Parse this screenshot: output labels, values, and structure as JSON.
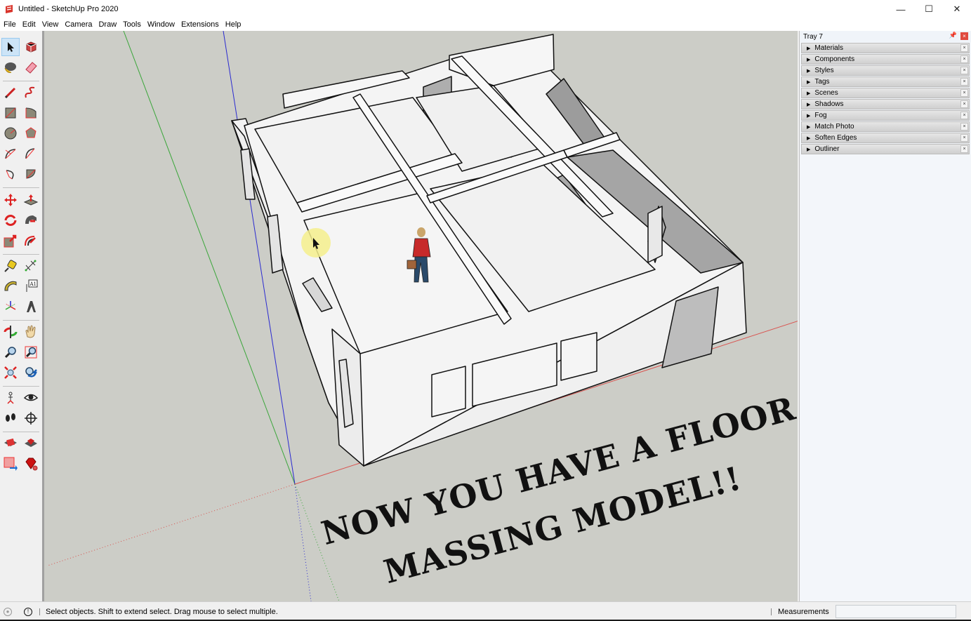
{
  "window": {
    "title": "Untitled - SketchUp Pro 2020",
    "controls": {
      "minimize": "—",
      "maximize": "☐",
      "close": "✕"
    }
  },
  "menubar": {
    "items": [
      {
        "label": "File"
      },
      {
        "label": "Edit"
      },
      {
        "label": "View"
      },
      {
        "label": "Camera"
      },
      {
        "label": "Draw"
      },
      {
        "label": "Tools"
      },
      {
        "label": "Window"
      },
      {
        "label": "Extensions"
      },
      {
        "label": "Help"
      }
    ]
  },
  "toolbar": {
    "tools": [
      {
        "name": "select-tool",
        "active": true
      },
      {
        "name": "make-component-tool"
      },
      {
        "name": "paint-bucket-tool"
      },
      {
        "name": "eraser-tool"
      },
      {
        "name": "line-tool"
      },
      {
        "name": "freehand-tool"
      },
      {
        "name": "rectangle-tool"
      },
      {
        "name": "rotated-rectangle-tool"
      },
      {
        "name": "circle-tool"
      },
      {
        "name": "polygon-tool"
      },
      {
        "name": "arc-tool"
      },
      {
        "name": "two-point-arc-tool"
      },
      {
        "name": "three-point-arc-tool"
      },
      {
        "name": "pie-tool"
      },
      {
        "name": "move-tool"
      },
      {
        "name": "push-pull-tool"
      },
      {
        "name": "rotate-tool"
      },
      {
        "name": "follow-me-tool"
      },
      {
        "name": "scale-tool"
      },
      {
        "name": "offset-tool"
      },
      {
        "name": "tape-measure-tool"
      },
      {
        "name": "dimension-tool"
      },
      {
        "name": "protractor-tool"
      },
      {
        "name": "text-tool"
      },
      {
        "name": "axes-tool"
      },
      {
        "name": "3d-text-tool"
      },
      {
        "name": "orbit-tool"
      },
      {
        "name": "pan-tool"
      },
      {
        "name": "zoom-tool"
      },
      {
        "name": "zoom-window-tool"
      },
      {
        "name": "zoom-extents-tool"
      },
      {
        "name": "previous-view-tool"
      },
      {
        "name": "position-camera-tool"
      },
      {
        "name": "look-around-tool"
      },
      {
        "name": "walk-tool"
      },
      {
        "name": "section-plane-tool"
      },
      {
        "name": "3d-warehouse-tool"
      },
      {
        "name": "extension-warehouse-tool"
      },
      {
        "name": "send-to-layout-tool"
      },
      {
        "name": "extension-manager-tool"
      }
    ],
    "text_tool_glyph": "A1"
  },
  "viewport": {
    "overlay_line1": "NOW YOU HAVE A FLOOR",
    "overlay_line2": "MASSING MODEL!!",
    "background_color": "#cccdc7",
    "axis_colors": {
      "red": "#d9534f",
      "green": "#3aa63a",
      "blue": "#2a2ad0"
    }
  },
  "tray": {
    "title": "Tray 7",
    "panels": [
      {
        "label": "Materials"
      },
      {
        "label": "Components"
      },
      {
        "label": "Styles"
      },
      {
        "label": "Tags"
      },
      {
        "label": "Scenes"
      },
      {
        "label": "Shadows"
      },
      {
        "label": "Fog"
      },
      {
        "label": "Match Photo"
      },
      {
        "label": "Soften Edges"
      },
      {
        "label": "Outliner"
      }
    ]
  },
  "statusbar": {
    "message": "Select objects. Shift to extend select. Drag mouse to select multiple.",
    "measurements_label": "Measurements",
    "measurements_value": ""
  }
}
